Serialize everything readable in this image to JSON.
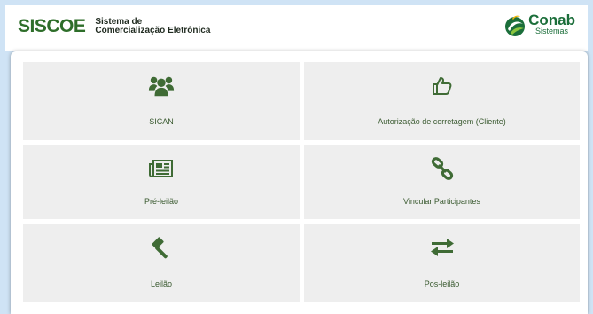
{
  "header": {
    "logo": "SISCOE",
    "subtitle_line1": "Sistema de",
    "subtitle_line2": "Comercialização Eletrônica",
    "partner_name": "Conab",
    "partner_sub": "Sistemas"
  },
  "tiles": [
    {
      "label": "SICAN",
      "icon": "users-icon"
    },
    {
      "label": "Autorização de corretagem (Cliente)",
      "icon": "thumbs-up-icon"
    },
    {
      "label": "Pré-leilão",
      "icon": "newspaper-icon"
    },
    {
      "label": "Vincular Participantes",
      "icon": "link-icon"
    },
    {
      "label": "Leilão",
      "icon": "gavel-icon"
    },
    {
      "label": "Pos-leilão",
      "icon": "exchange-icon"
    }
  ],
  "colors": {
    "accent": "#3f6b35",
    "background": "#cfe3f5",
    "tile": "#eeeeee"
  }
}
